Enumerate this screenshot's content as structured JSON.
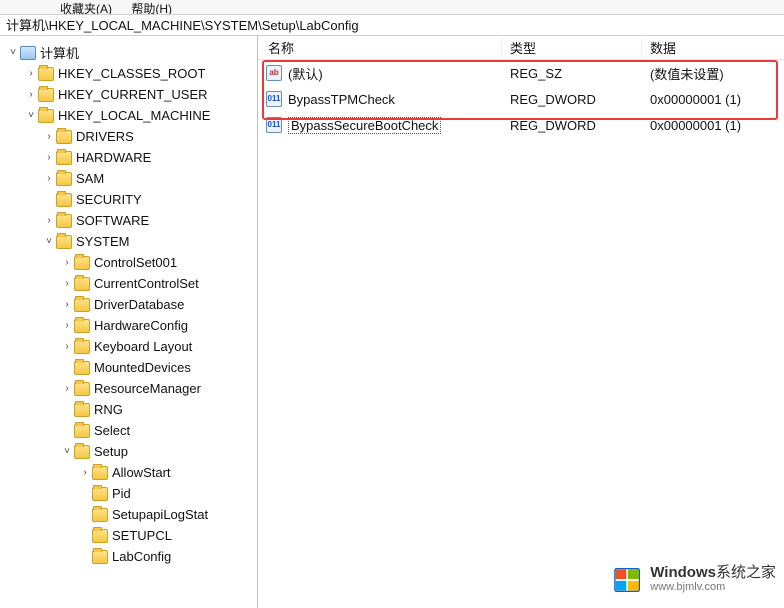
{
  "menubar": {
    "items": [
      "收藏夹(A)",
      "帮助(H)"
    ]
  },
  "address": "计算机\\HKEY_LOCAL_MACHINE\\SYSTEM\\Setup\\LabConfig",
  "tree": {
    "root": "计算机",
    "nodes": [
      {
        "depth": 1,
        "exp": ">",
        "label": "HKEY_CLASSES_ROOT"
      },
      {
        "depth": 1,
        "exp": ">",
        "label": "HKEY_CURRENT_USER"
      },
      {
        "depth": 1,
        "exp": "v",
        "label": "HKEY_LOCAL_MACHINE"
      },
      {
        "depth": 2,
        "exp": ">",
        "label": "DRIVERS"
      },
      {
        "depth": 2,
        "exp": ">",
        "label": "HARDWARE"
      },
      {
        "depth": 2,
        "exp": ">",
        "label": "SAM"
      },
      {
        "depth": 2,
        "exp": "",
        "label": "SECURITY"
      },
      {
        "depth": 2,
        "exp": ">",
        "label": "SOFTWARE"
      },
      {
        "depth": 2,
        "exp": "v",
        "label": "SYSTEM"
      },
      {
        "depth": 3,
        "exp": ">",
        "label": "ControlSet001"
      },
      {
        "depth": 3,
        "exp": ">",
        "label": "CurrentControlSet"
      },
      {
        "depth": 3,
        "exp": ">",
        "label": "DriverDatabase"
      },
      {
        "depth": 3,
        "exp": ">",
        "label": "HardwareConfig"
      },
      {
        "depth": 3,
        "exp": ">",
        "label": "Keyboard Layout"
      },
      {
        "depth": 3,
        "exp": "",
        "label": "MountedDevices"
      },
      {
        "depth": 3,
        "exp": ">",
        "label": "ResourceManager"
      },
      {
        "depth": 3,
        "exp": "",
        "label": "RNG"
      },
      {
        "depth": 3,
        "exp": "",
        "label": "Select"
      },
      {
        "depth": 3,
        "exp": "v",
        "label": "Setup"
      },
      {
        "depth": 4,
        "exp": ">",
        "label": "AllowStart"
      },
      {
        "depth": 4,
        "exp": "",
        "label": "Pid"
      },
      {
        "depth": 4,
        "exp": "",
        "label": "SetupapiLogStat"
      },
      {
        "depth": 4,
        "exp": "",
        "label": "SETUPCL"
      },
      {
        "depth": 4,
        "exp": "",
        "label": "LabConfig"
      }
    ]
  },
  "list": {
    "headers": {
      "name": "名称",
      "type": "类型",
      "data": "数据"
    },
    "rows": [
      {
        "icon": "str",
        "name": "(默认)",
        "type": "REG_SZ",
        "data": "(数值未设置)",
        "selected": false
      },
      {
        "icon": "bin",
        "name": "BypassTPMCheck",
        "type": "REG_DWORD",
        "data": "0x00000001 (1)",
        "selected": false
      },
      {
        "icon": "bin",
        "name": "BypassSecureBootCheck",
        "type": "REG_DWORD",
        "data": "0x00000001 (1)",
        "selected": true
      }
    ]
  },
  "watermark": {
    "title_prefix": "Windows",
    "title_suffix": "系统之家",
    "url": "www.bjmlv.com"
  }
}
